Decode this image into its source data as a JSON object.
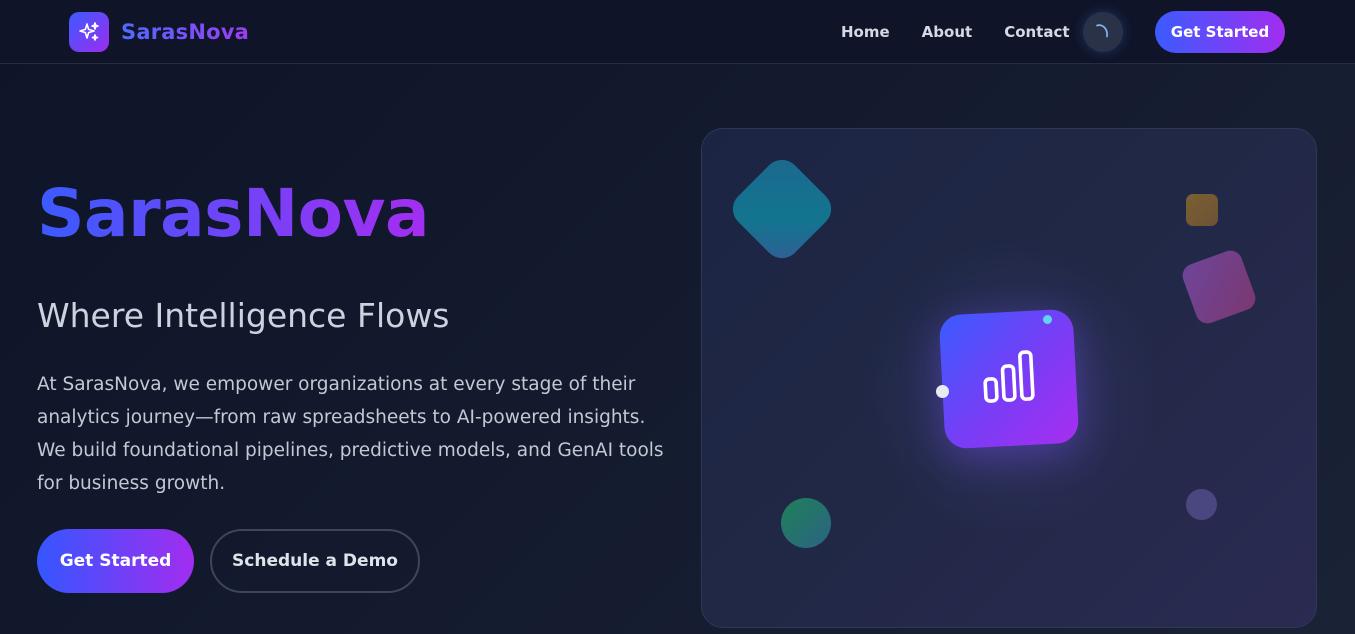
{
  "navbar": {
    "brand_name": "SarasNova",
    "links": [
      {
        "label": "Home"
      },
      {
        "label": "About"
      },
      {
        "label": "Contact"
      }
    ],
    "cta_label": "Get Started",
    "icons": {
      "logo": "sparkles-icon",
      "theme_toggle": "moon-icon"
    }
  },
  "hero": {
    "title": "SarasNova",
    "subtitle": "Where Intelligence Flows",
    "description": "At SarasNova, we empower organizations at every stage of their analytics journey—from raw spreadsheets to AI-powered insights. We build foundational pipelines, predictive models, and GenAI tools for business growth.",
    "primary_button": "Get Started",
    "secondary_button": "Schedule a Demo"
  },
  "visual": {
    "center_icon": "bar-chart-icon"
  },
  "colors": {
    "gradient_start": "#3b5bff",
    "gradient_end": "#a22df0",
    "background": "#131a2e"
  }
}
